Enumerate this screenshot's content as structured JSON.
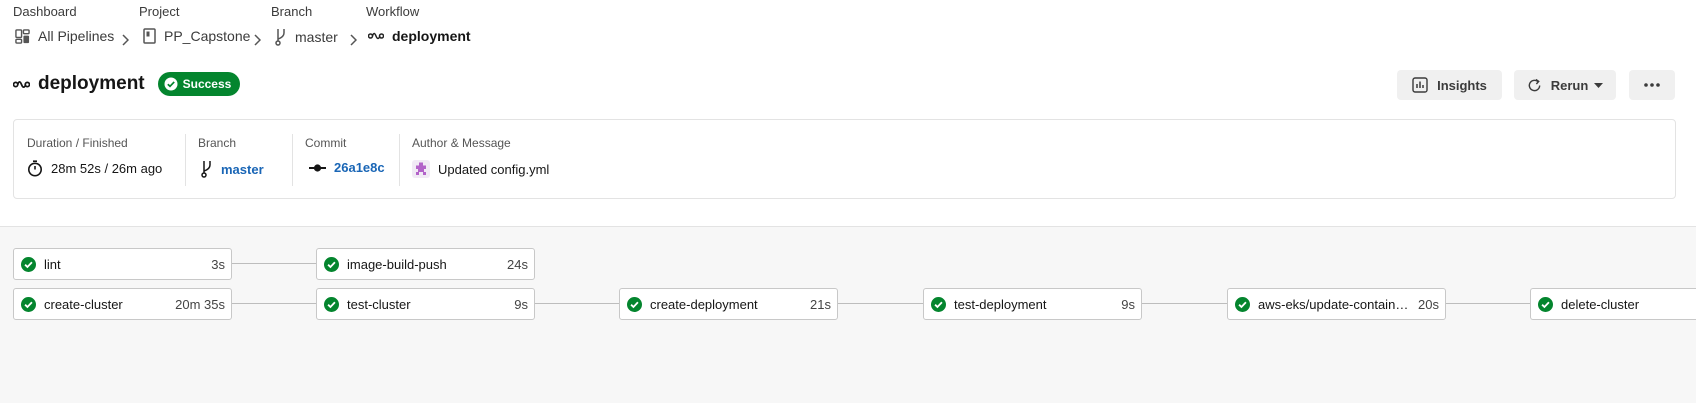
{
  "breadcrumb": {
    "dashboard": {
      "label": "Dashboard",
      "value": "All Pipelines"
    },
    "project": {
      "label": "Project",
      "value": "PP_Capstone"
    },
    "branch": {
      "label": "Branch",
      "value": "master"
    },
    "workflow": {
      "label": "Workflow",
      "value": "deployment"
    }
  },
  "header": {
    "title": "deployment",
    "status": "Success",
    "insights_label": "Insights",
    "rerun_label": "Rerun"
  },
  "info": {
    "duration_label": "Duration / Finished",
    "duration_value": "28m 52s / 26m ago",
    "branch_label": "Branch",
    "branch_value": "master",
    "commit_label": "Commit",
    "commit_value": "26a1e8c",
    "author_label": "Author & Message",
    "message": "Updated config.yml"
  },
  "jobs": [
    {
      "name": "lint",
      "duration": "3s",
      "status": "success"
    },
    {
      "name": "image-build-push",
      "duration": "24s",
      "status": "success"
    },
    {
      "name": "create-cluster",
      "duration": "20m 35s",
      "status": "success"
    },
    {
      "name": "test-cluster",
      "duration": "9s",
      "status": "success"
    },
    {
      "name": "create-deployment",
      "duration": "21s",
      "status": "success"
    },
    {
      "name": "test-deployment",
      "duration": "9s",
      "status": "success"
    },
    {
      "name": "aws-eks/update-container-image",
      "duration": "20s",
      "status": "success"
    },
    {
      "name": "delete-cluster",
      "duration": "",
      "status": "success"
    }
  ],
  "colors": {
    "success": "#04852e",
    "link": "#1a66b6"
  }
}
